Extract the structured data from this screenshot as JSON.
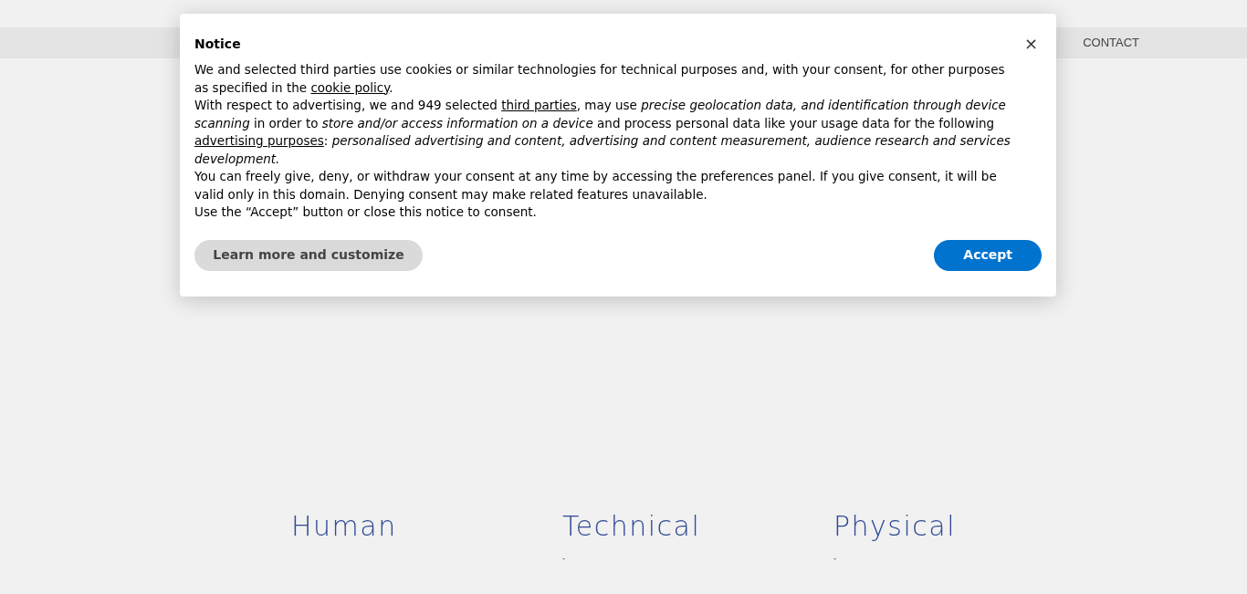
{
  "nav": {
    "items": [
      "CONTACT"
    ]
  },
  "columns": [
    {
      "title": "Human"
    },
    {
      "title": "Technical",
      "note": "-"
    },
    {
      "title": "Physical",
      "note": "-"
    }
  ],
  "dialog": {
    "title": "Notice",
    "close": "×",
    "paragraphs": [
      [
        {
          "kind": "text",
          "text": "We and selected third parties use cookies or similar technologies for technical purposes and, with your consent, for other purposes as specified in the "
        },
        {
          "kind": "link",
          "text": "cookie policy"
        },
        {
          "kind": "text",
          "text": "."
        }
      ],
      [
        {
          "kind": "text",
          "text": "With respect to advertising, we and 949 selected "
        },
        {
          "kind": "link",
          "text": "third parties"
        },
        {
          "kind": "text",
          "text": ", may use *precise geolocation data, and identification through device scanning* in order to *store and/or access information on a device* and process personal data like your usage data for the following "
        },
        {
          "kind": "link",
          "text": "advertising purposes"
        },
        {
          "kind": "text",
          "text": ": *personalised advertising and content, advertising and content measurement, audience research and services development.*"
        }
      ],
      [
        {
          "kind": "text",
          "text": "You can freely give, deny, or withdraw your consent at any time by accessing the preferences panel. If you give consent, it will be valid only in this domain. Denying consent may make related features unavailable."
        }
      ],
      [
        {
          "kind": "text",
          "text": "Use the “Accept” button or close this notice to consent."
        }
      ]
    ],
    "buttons": [
      {
        "label": "Learn more and customize",
        "kind": "secondary"
      },
      {
        "label": "Accept",
        "kind": "primary"
      }
    ]
  }
}
